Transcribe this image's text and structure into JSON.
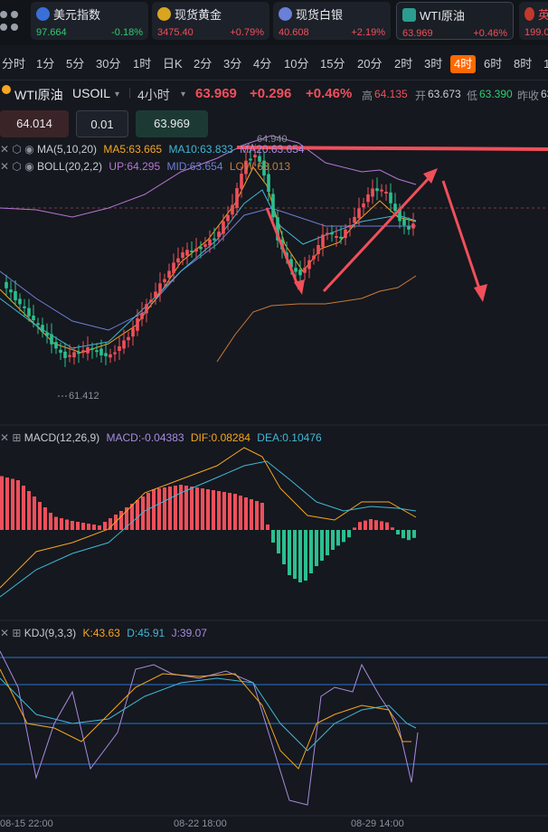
{
  "tickers": [
    {
      "name": "美元指数",
      "price": "97.664",
      "change": "-0.18%",
      "dir": "down",
      "flag": "#3a6fd8",
      "price_color": "#2ecc71"
    },
    {
      "name": "现货黄金",
      "price": "3475.40",
      "change": "+0.79%",
      "dir": "up",
      "flag": "#d9a520",
      "price_color": "#f04f5b"
    },
    {
      "name": "现货白银",
      "price": "40.608",
      "change": "+2.19%",
      "dir": "up",
      "flag": "#6a7fd8",
      "price_color": "#f04f5b"
    },
    {
      "name": "WTI原油",
      "price": "63.969",
      "change": "+0.46%",
      "dir": "up",
      "flag": "#2a9d8f",
      "price_color": "#f04f5b"
    },
    {
      "name": "英",
      "price": "199.0",
      "change": "",
      "dir": "up",
      "flag": "#c0392b",
      "price_color": "#f04f5b"
    }
  ],
  "periods": [
    "分时",
    "1分",
    "5分",
    "30分",
    "1时",
    "日K",
    "2分",
    "3分",
    "4分",
    "10分",
    "15分",
    "20分",
    "2时",
    "3时",
    "4时",
    "6时",
    "8时",
    "1"
  ],
  "active_period": "4时",
  "symbol": {
    "name": "WTI原油",
    "code": "USOIL",
    "interval": "4小时",
    "price": "63.969",
    "change": "+0.296",
    "change_pct": "+0.46%",
    "high_label": "高",
    "high": "64.135",
    "open_label": "开",
    "open": "63.673",
    "low_label": "低",
    "low": "63.390",
    "prev_label": "昨收",
    "prev": "63"
  },
  "order": {
    "price_left": "64.014",
    "qty": "0.01",
    "price_right": "63.969"
  },
  "main_indicators": {
    "ma_label": "MA(5,10,20)",
    "ma5": "MA5:63.665",
    "ma10": "MA10:63.833",
    "ma20": "MA20:63.654",
    "boll_label": "BOLL(20,2,2)",
    "boll_up": "UP:64.295",
    "boll_mid": "MID:63.654",
    "boll_low": "LOW:63.013",
    "marker_high": "64.940",
    "marker_low": "61.412"
  },
  "macd": {
    "label": "MACD(12,26,9)",
    "macd": "MACD:-0.04383",
    "dif": "DIF:0.08284",
    "dea": "DEA:0.10476"
  },
  "kdj": {
    "label": "KDJ(9,3,3)",
    "k": "K:43.63",
    "d": "D:45.91",
    "j": "J:39.07"
  },
  "time_axis": [
    "08-15 22:00",
    "08-22 18:00",
    "08-29 14:00"
  ],
  "colors": {
    "up": "#f04f5b",
    "down": "#2bbf8f",
    "ma5": "#f5a623",
    "ma10": "#3fb8d8",
    "ma20": "#a78be0",
    "boll_up": "#b576d6",
    "boll_mid": "#6f7dd8",
    "boll_low": "#c97a3a",
    "accent": "#ff6a00"
  }
}
